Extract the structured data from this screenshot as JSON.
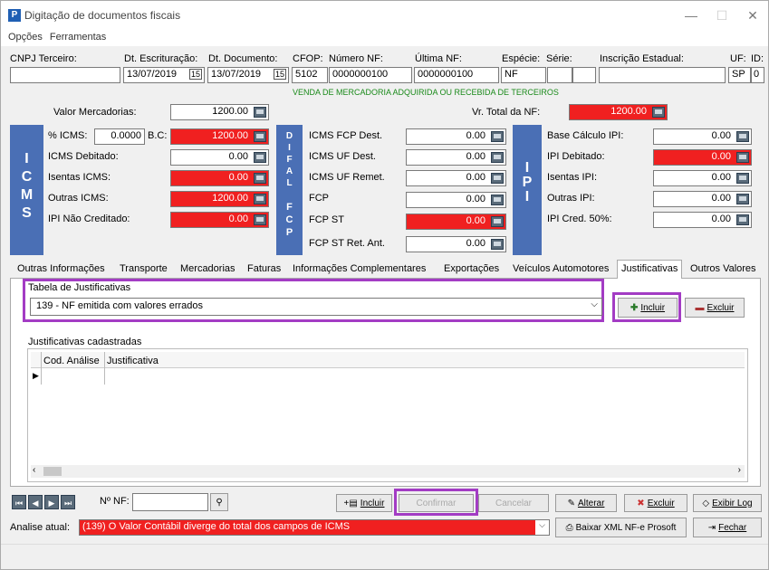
{
  "window": {
    "title": "Digitação de documentos fiscais",
    "minimize_icon": "minimize-icon",
    "maximize_icon": "maximize-icon",
    "close_icon": "close-icon"
  },
  "menu": {
    "opcoes": "Opções",
    "ferramentas": "Ferramentas"
  },
  "header": {
    "cnpj_label": "CNPJ Terceiro:",
    "cnpj_value": "",
    "dt_escrituracao_label": "Dt. Escrituração:",
    "dt_escrituracao_value": "13/07/2019",
    "dt_documento_label": "Dt. Documento:",
    "dt_documento_value": "13/07/2019",
    "cfop_label": "CFOP:",
    "cfop_value": "5102",
    "numero_nf_label": "Número NF:",
    "numero_nf_value": "0000000100",
    "ultima_nf_label": "Última NF:",
    "ultima_nf_value": "0000000100",
    "especie_label": "Espécie:",
    "especie_value": "NF",
    "serie_label": "Série:",
    "serie_value": "",
    "inscricao_label": "Inscrição Estadual:",
    "inscricao_value": "",
    "uf_label": "UF:",
    "uf_value": "SP",
    "id_label": "ID:",
    "id_value": "0",
    "cfop_description": "VENDA DE MERCADORIA ADQUIRIDA OU RECEBIDA DE TERCEIROS"
  },
  "valores": {
    "mercadorias_label": "Valor Mercadorias:",
    "mercadorias_value": "1200.00",
    "total_label": "Vr. Total da NF:",
    "total_value": "1200.00"
  },
  "icms": {
    "band": [
      "I",
      "C",
      "M",
      "S"
    ],
    "perc_label": "% ICMS:",
    "perc_value": "0.0000",
    "bc_label": "B.C:",
    "bc_value": "1200.00",
    "debitado_label": "ICMS Debitado:",
    "debitado_value": "0.00",
    "isentas_label": "Isentas ICMS:",
    "isentas_value": "0.00",
    "outras_label": "Outras ICMS:",
    "outras_value": "1200.00",
    "ipi_nao_label": "IPI Não Creditado:",
    "ipi_nao_value": "0.00"
  },
  "difal": {
    "band": [
      "D",
      "I",
      "F",
      "A",
      "L"
    ],
    "fcp_dest_label": "ICMS FCP Dest.",
    "fcp_dest_value": "0.00",
    "uf_dest_label": "ICMS UF Dest.",
    "uf_dest_value": "0.00",
    "uf_remet_label": "ICMS UF Remet.",
    "uf_remet_value": "0.00"
  },
  "fcp": {
    "band": [
      "F",
      "C",
      "P"
    ],
    "fcp_label": "FCP",
    "fcp_value": "0.00",
    "fcp_st_label": "FCP ST",
    "fcp_st_value": "0.00",
    "fcp_st_ret_label": "FCP ST Ret. Ant.",
    "fcp_st_ret_value": "0.00"
  },
  "ipi": {
    "band": [
      "I",
      "P",
      "I"
    ],
    "base_label": "Base Cálculo IPI:",
    "base_value": "0.00",
    "debitado_label": "IPI Debitado:",
    "debitado_value": "0.00",
    "isentas_label": "Isentas IPI:",
    "isentas_value": "0.00",
    "outras_label": "Outras IPI:",
    "outras_value": "0.00",
    "cred_label": "IPI Cred. 50%:",
    "cred_value": "0.00"
  },
  "tabs": [
    "Outras Informações",
    "Transporte",
    "Mercadorias",
    "Faturas",
    "Informações Complementares",
    "Exportações",
    "Veículos Automotores",
    "Justificativas",
    "Outros Valores"
  ],
  "justificativas": {
    "tabela_label": "Tabela de Justificativas",
    "selected": "139 - NF emitida com valores errados",
    "incluir": "Incluir",
    "excluir": "Excluir",
    "cadastradas_label": "Justificativas cadastradas",
    "col_cod": "Cod. Análise",
    "col_just": "Justificativa"
  },
  "footer": {
    "nf_label": "Nº NF:",
    "nf_value": "",
    "incluir": "Incluir",
    "confirmar": "Confirmar",
    "cancelar": "Cancelar",
    "alterar": "Alterar",
    "excluir": "Excluir",
    "exibir_log": "Exibir Log",
    "analise_label": "Analise atual:",
    "analise_value": "(139) O Valor Contábil diverge do total dos campos de ICMS",
    "baixar_xml": "Baixar XML NF-e Prosoft",
    "fechar": "Fechar"
  }
}
